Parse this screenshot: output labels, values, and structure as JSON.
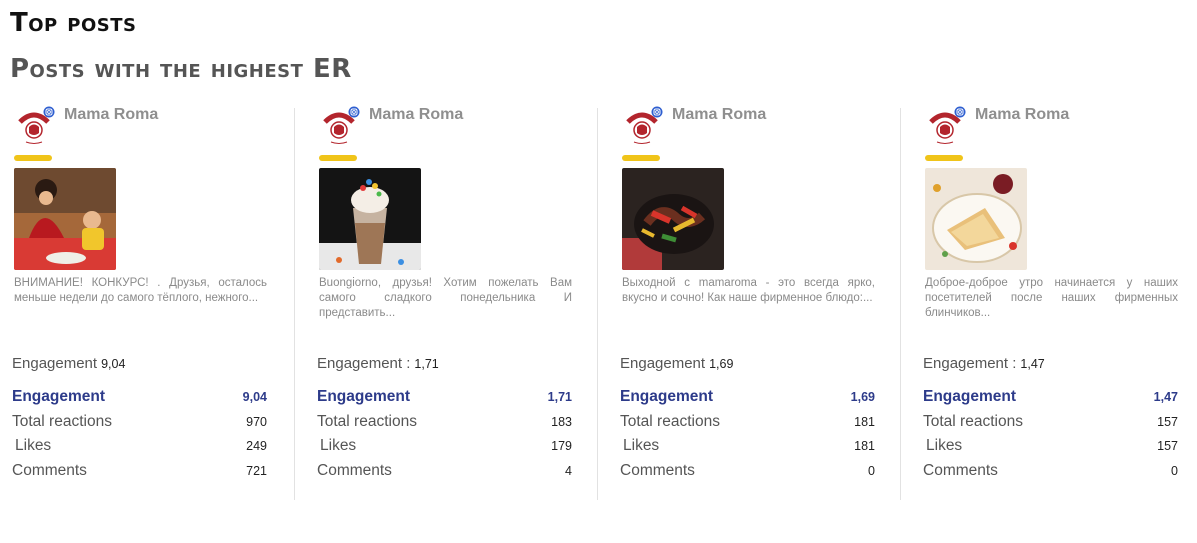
{
  "header": {
    "title": "Top posts",
    "subtitle": "Posts with the highest ER"
  },
  "accent_color": "#f0c419",
  "highlight_color": "#2d3b8a",
  "cards": [
    {
      "brand": "Mama Roma",
      "caption": "ВНИМАНИЕ! КОНКУРС! . Друзья, осталось меньше недели до самого тёплого, нежного...",
      "engagement_label": "Engagement",
      "engagement_value": "9,04",
      "stats": [
        {
          "label": "Engagement",
          "value": "9,04"
        },
        {
          "label": "Total reactions",
          "value": "970"
        },
        {
          "label": "Likes",
          "value": "249"
        },
        {
          "label": "Comments",
          "value": "721"
        }
      ]
    },
    {
      "brand": "Mama Roma",
      "caption": "Buongiorno, друзья! Хотим пожелать Вам самого сладкого понедельника И представить...",
      "engagement_label": "Engagement :",
      "engagement_value": "1,71",
      "stats": [
        {
          "label": "Engagement",
          "value": "1,71"
        },
        {
          "label": "Total reactions",
          "value": "183"
        },
        {
          "label": "Likes",
          "value": "179"
        },
        {
          "label": "Comments",
          "value": "4"
        }
      ]
    },
    {
      "brand": "Mama Roma",
      "caption": "Выходной с mamaroma - это всегда ярко, вкусно и сочно! Как наше фирменное блюдо:...",
      "engagement_label": "Engagement",
      "engagement_value": "1,69",
      "stats": [
        {
          "label": "Engagement",
          "value": "1,69"
        },
        {
          "label": "Total reactions",
          "value": "181"
        },
        {
          "label": "Likes",
          "value": "181"
        },
        {
          "label": "Comments",
          "value": "0"
        }
      ]
    },
    {
      "brand": "Mama Roma",
      "caption": "Доброе-доброе утро начинается у наших посетителей после наших фирменных блинчиков...",
      "engagement_label": "Engagement :",
      "engagement_value": "1,47",
      "stats": [
        {
          "label": "Engagement",
          "value": "1,47"
        },
        {
          "label": "Total reactions",
          "value": "157"
        },
        {
          "label": "Likes",
          "value": "157"
        },
        {
          "label": "Comments",
          "value": "0"
        }
      ]
    }
  ],
  "icons": {
    "logo": "mama-roma-logo",
    "social": "instagram-icon"
  }
}
